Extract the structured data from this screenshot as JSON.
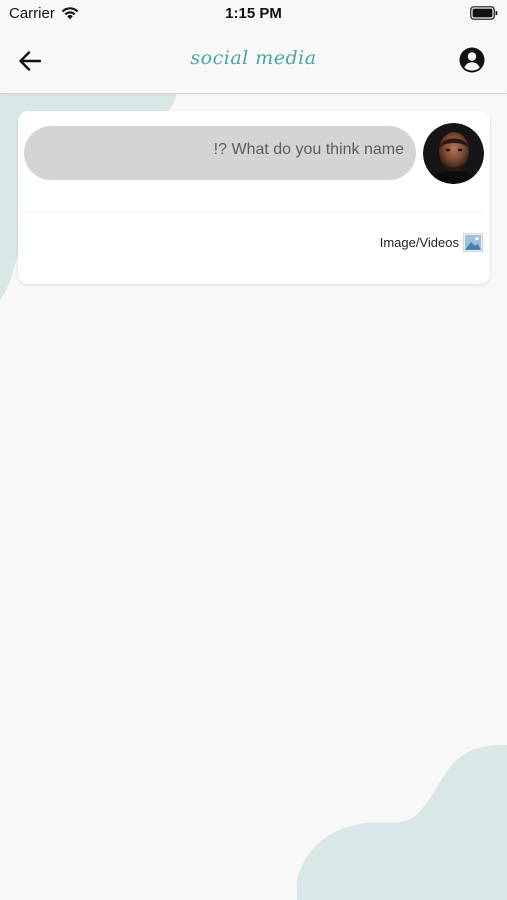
{
  "status_bar": {
    "carrier": "Carrier",
    "time": "1:15 PM"
  },
  "nav": {
    "title": "social media",
    "back_icon": "arrow-left-icon",
    "profile_icon": "account-circle-icon"
  },
  "composer": {
    "input_placeholder": "!? What do you think name",
    "media_label": "Image/Videos",
    "media_icon": "image-icon"
  },
  "colors": {
    "brand_teal": "#49a5a1",
    "blob": "#d9e8e7",
    "background": "#f7f8f7",
    "input_fill": "#d4d4d4"
  }
}
